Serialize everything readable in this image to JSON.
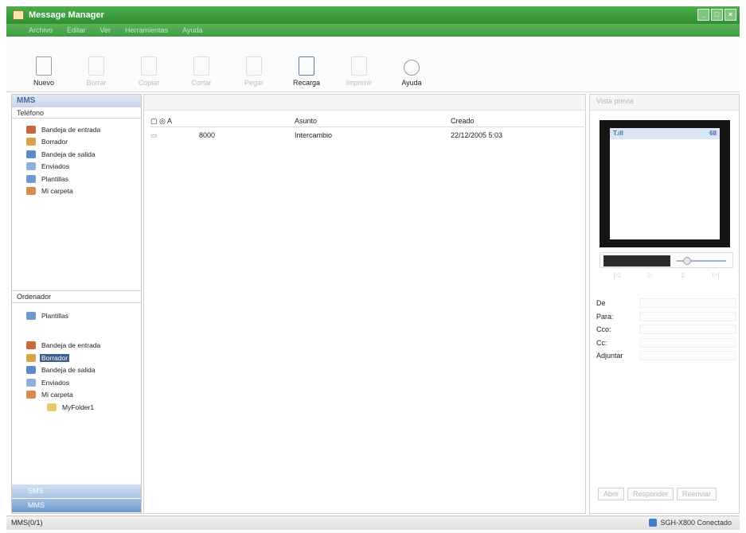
{
  "window": {
    "title": "Message Manager",
    "controls": [
      "_",
      "□",
      "×"
    ]
  },
  "menu": [
    "Archivo",
    "Editar",
    "Ver",
    "Herramientas",
    "Ayuda"
  ],
  "toolbar": [
    {
      "label": "Nuevo",
      "enabled": true
    },
    {
      "label": "Borrar",
      "enabled": false
    },
    {
      "label": "Copiar",
      "enabled": false
    },
    {
      "label": "Cortar",
      "enabled": false
    },
    {
      "label": "Pegar",
      "enabled": false
    },
    {
      "label": "Recarga",
      "enabled": true
    },
    {
      "label": "Imprimir",
      "enabled": false
    },
    {
      "label": "Ayuda",
      "enabled": true
    }
  ],
  "left": {
    "header": "MMS",
    "phone_label": "Teléfono",
    "phone_items": [
      "Bandeja de entrada",
      "Borrador",
      "Bandeja de salida",
      "Enviados",
      "Plantillas",
      "Mi carpeta"
    ],
    "pc_label": "Ordenador",
    "pc_items": [
      "Plantillas",
      "Bandeja de entrada",
      "Borrador",
      "Bandeja de salida",
      "Enviados",
      "Mi carpeta",
      "MyFolder1"
    ],
    "tabs": [
      "SMS",
      "MMS"
    ]
  },
  "list": {
    "columns": [
      "A",
      "Asunto",
      "Creado"
    ],
    "rows": [
      {
        "to": "8000",
        "subject": "Intercambio",
        "created": "22/12/2005 5:03"
      }
    ]
  },
  "preview": {
    "header": "Vista previa",
    "screen_left": "T.ıll",
    "screen_right": "68",
    "fields": [
      "De",
      "Para:",
      "Cco:",
      "Cc:",
      "Adjuntar"
    ],
    "buttons": [
      "Abrir",
      "Responder",
      "Reenviar"
    ]
  },
  "status": {
    "left": "MMS(0/1)",
    "right": "SGH-X800 Conectado"
  }
}
